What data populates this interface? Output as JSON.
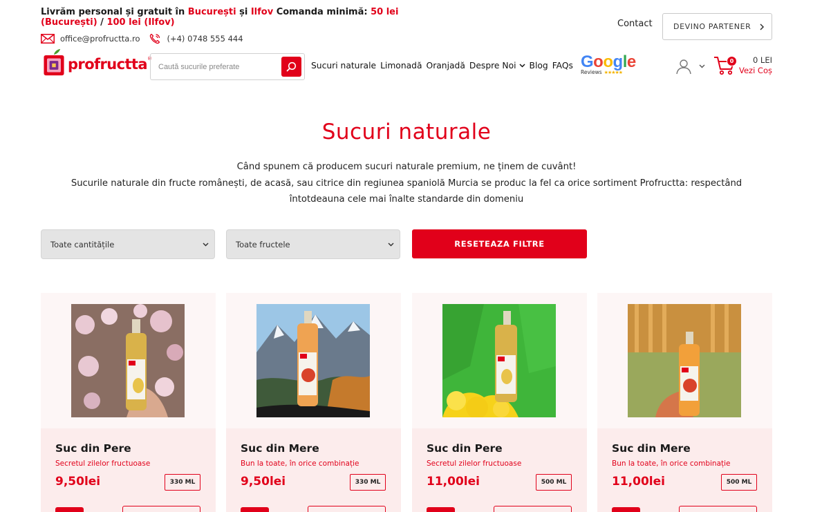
{
  "topbar": {
    "ship_prefix": "Livrăm personal și gratuit în ",
    "city1": "București",
    "and": " și ",
    "city2": "Ilfov",
    "min_text": " Comanda minimă: ",
    "price1": "50 lei (București)",
    "slash": " / ",
    "price2": "100 lei (Ilfov)",
    "email": "office@profructta.ro",
    "phone": "(+4) 0748 555 444",
    "contact": "Contact",
    "partner": "DEVINO PARTENER"
  },
  "logo": {
    "text": "profructta",
    "reg": "®"
  },
  "search": {
    "placeholder": "Caută sucurile preferate"
  },
  "nav": [
    "Sucuri naturale",
    "Limonadă",
    "Oranjadă",
    "Despre Noi",
    "Blog",
    "FAQs"
  ],
  "google": {
    "letters": [
      "G",
      "o",
      "o",
      "g",
      "l",
      "e"
    ],
    "colors": [
      "#4285F4",
      "#EA4335",
      "#FBBC05",
      "#4285F4",
      "#34A853",
      "#EA4335"
    ],
    "reviews": "Reviews",
    "stars": "★★★★★"
  },
  "cart": {
    "count": "0",
    "amount": "0 LEI",
    "see": "Vezi Coș"
  },
  "page": {
    "title": "Sucuri naturale",
    "intro1": "Când spunem că producem sucuri naturale premium, ne ținem de cuvânt!",
    "intro2": "Sucurile naturale din fructe românești, de acasă, sau citrice din regiunea spaniolă Murcia se produc la fel ca orice sortiment Profructta: respectând",
    "intro3": "întotdeauna cele mai înalte standarde din domeniu"
  },
  "filters": {
    "quantity": "Toate cantitățile",
    "fruit": "Toate fructele",
    "reset": "RESETEAZA FILTRE"
  },
  "products": [
    {
      "name": "Suc din Pere",
      "tagline": "Secretul zilelor fructuoase",
      "price": "9,50lei",
      "qty": "330 ML"
    },
    {
      "name": "Suc din Mere",
      "tagline": "Bun la toate, în orice combinație",
      "price": "9,50lei",
      "qty": "330 ML"
    },
    {
      "name": "Suc din Pere",
      "tagline": "Secretul zilelor fructuoase",
      "price": "11,00lei",
      "qty": "500 ML"
    },
    {
      "name": "Suc din Mere",
      "tagline": "Bun la toate, în orice combinație",
      "price": "11,00lei",
      "qty": "500 ML"
    }
  ],
  "colors": {
    "brand_red": "#e1001a",
    "card_bg": "#fdf6f6",
    "card_info_bg": "#fcecec"
  }
}
